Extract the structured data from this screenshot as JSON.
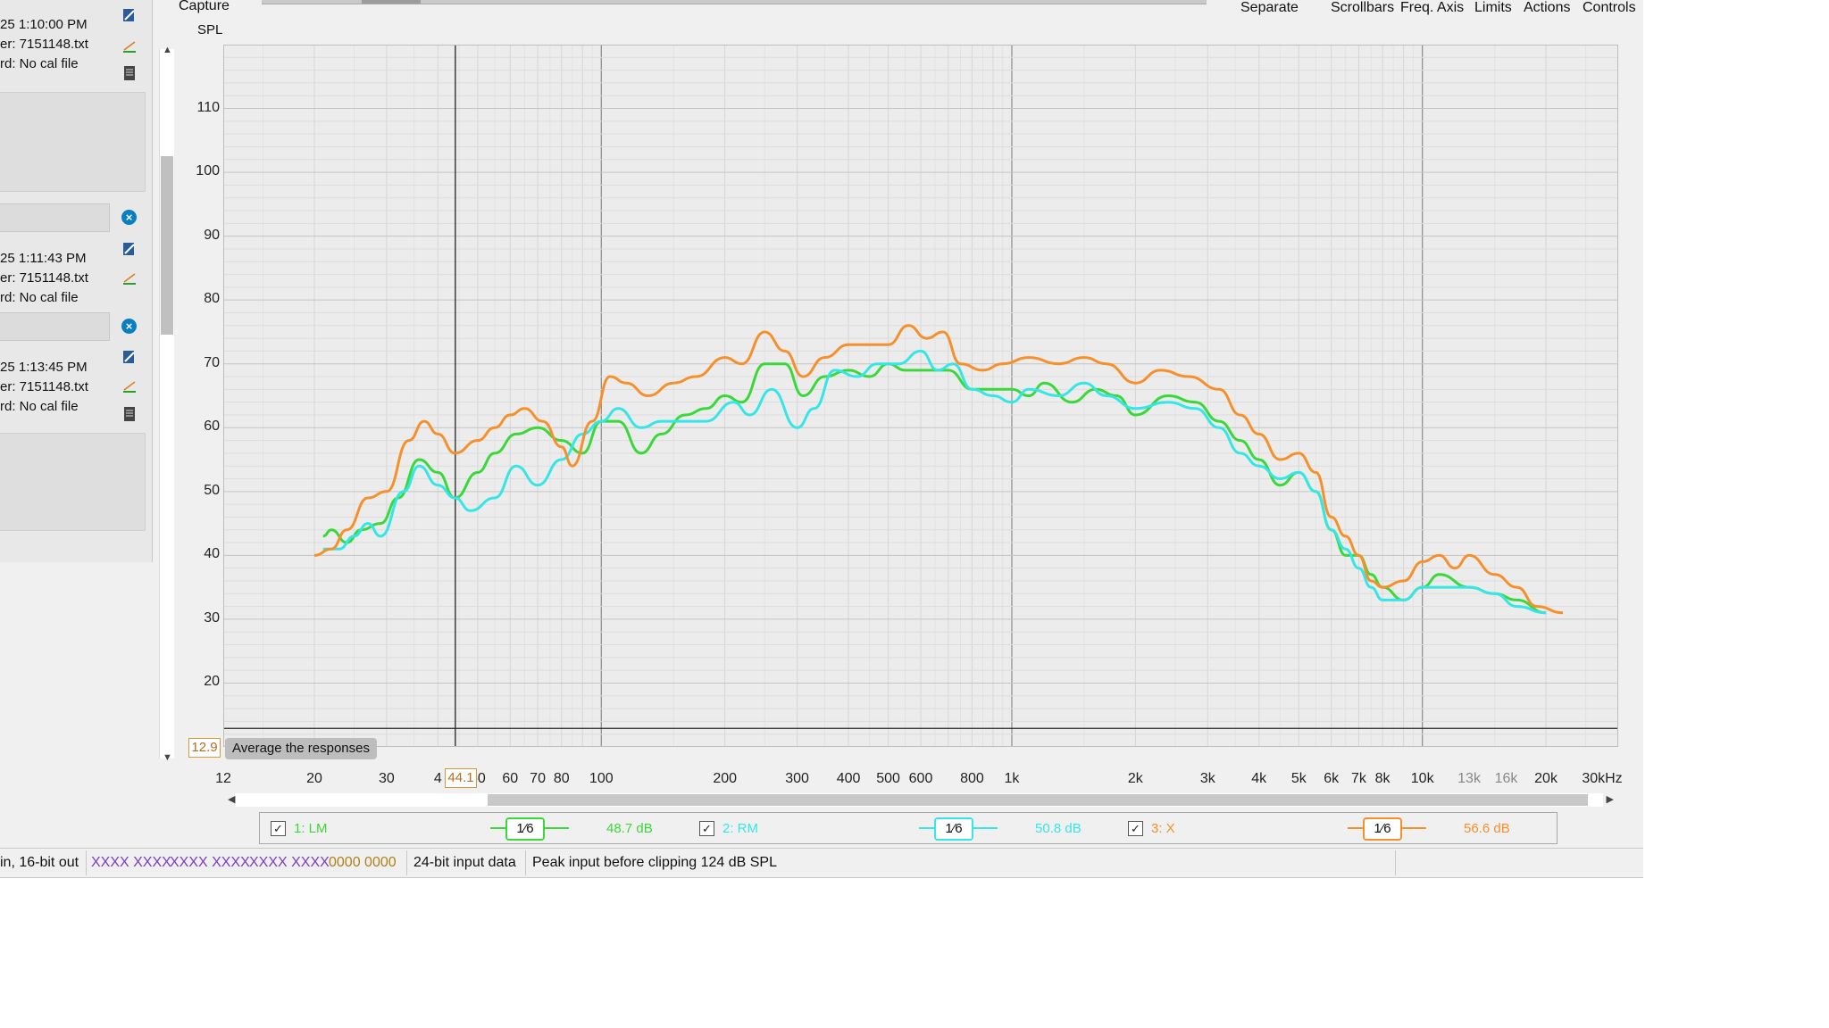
{
  "left_panel": {
    "measurements": [
      {
        "time": "25 1:10:00 PM",
        "mic": "er: 7151148.txt",
        "cal": "rd: No cal file"
      },
      {
        "time": "25 1:11:43 PM",
        "mic": "er: 7151148.txt",
        "cal": "rd: No cal file"
      },
      {
        "time": "25 1:13:45 PM",
        "mic": "er: 7151148.txt",
        "cal": "rd: No cal file"
      }
    ]
  },
  "toolbar": {
    "capture_label": "Capture",
    "menu": [
      "Separate",
      "Scrollbars",
      "Freq. Axis",
      "Limits",
      "Actions",
      "Controls"
    ]
  },
  "chart": {
    "y_axis_label": "SPL",
    "y_ticks": [
      "110",
      "100",
      "90",
      "80",
      "70",
      "60",
      "50",
      "40",
      "30",
      "20"
    ],
    "x_ticks": [
      {
        "label": "12",
        "f": 12,
        "dim": false
      },
      {
        "label": "20",
        "f": 20,
        "dim": false
      },
      {
        "label": "30",
        "f": 30,
        "dim": false
      },
      {
        "label": "4",
        "f": 40,
        "dim": false
      },
      {
        "label": "50",
        "f": 50,
        "dim": false
      },
      {
        "label": "60",
        "f": 60,
        "dim": false
      },
      {
        "label": "70",
        "f": 70,
        "dim": false
      },
      {
        "label": "80",
        "f": 80,
        "dim": false
      },
      {
        "label": "100",
        "f": 100,
        "dim": false
      },
      {
        "label": "200",
        "f": 200,
        "dim": false
      },
      {
        "label": "300",
        "f": 300,
        "dim": false
      },
      {
        "label": "400",
        "f": 400,
        "dim": false
      },
      {
        "label": "500",
        "f": 500,
        "dim": false
      },
      {
        "label": "600",
        "f": 600,
        "dim": false
      },
      {
        "label": "800",
        "f": 800,
        "dim": false
      },
      {
        "label": "1k",
        "f": 1000,
        "dim": false
      },
      {
        "label": "2k",
        "f": 2000,
        "dim": false
      },
      {
        "label": "3k",
        "f": 3000,
        "dim": false
      },
      {
        "label": "4k",
        "f": 4000,
        "dim": false
      },
      {
        "label": "5k",
        "f": 5000,
        "dim": false
      },
      {
        "label": "6k",
        "f": 6000,
        "dim": false
      },
      {
        "label": "7k",
        "f": 7000,
        "dim": false
      },
      {
        "label": "8k",
        "f": 8000,
        "dim": false
      },
      {
        "label": "10k",
        "f": 10000,
        "dim": false
      },
      {
        "label": "13k",
        "f": 13000,
        "dim": true
      },
      {
        "label": "16k",
        "f": 16000,
        "dim": true
      },
      {
        "label": "20k",
        "f": 20000,
        "dim": false
      },
      {
        "label": "30kHz",
        "f": 30000,
        "dim": false
      }
    ],
    "cursor_y_value": "12.9",
    "cursor_x_value": "44.1",
    "tooltip": "Average the responses"
  },
  "chart_data": {
    "type": "line",
    "x_scale": "log",
    "xlim": [
      12,
      30000
    ],
    "ylim": [
      10,
      120
    ],
    "series": [
      {
        "name": "1: LM",
        "color": "#3ad83a",
        "points": [
          [
            21,
            43
          ],
          [
            22,
            44
          ],
          [
            24,
            42
          ],
          [
            26,
            44
          ],
          [
            29,
            45
          ],
          [
            32,
            49
          ],
          [
            36,
            55
          ],
          [
            40,
            53
          ],
          [
            44,
            49
          ],
          [
            50,
            53
          ],
          [
            55,
            56
          ],
          [
            62,
            59
          ],
          [
            70,
            60
          ],
          [
            80,
            58
          ],
          [
            90,
            56
          ],
          [
            100,
            61
          ],
          [
            110,
            61
          ],
          [
            125,
            56
          ],
          [
            140,
            59
          ],
          [
            160,
            62
          ],
          [
            180,
            63
          ],
          [
            200,
            65
          ],
          [
            220,
            64
          ],
          [
            250,
            70
          ],
          [
            280,
            70
          ],
          [
            310,
            65
          ],
          [
            350,
            68
          ],
          [
            400,
            69
          ],
          [
            450,
            68
          ],
          [
            500,
            70
          ],
          [
            550,
            69
          ],
          [
            600,
            69
          ],
          [
            700,
            69
          ],
          [
            800,
            66
          ],
          [
            900,
            66
          ],
          [
            1000,
            66
          ],
          [
            1100,
            65
          ],
          [
            1200,
            67
          ],
          [
            1400,
            64
          ],
          [
            1600,
            66
          ],
          [
            1800,
            65
          ],
          [
            2000,
            62
          ],
          [
            2400,
            65
          ],
          [
            2800,
            64
          ],
          [
            3200,
            61
          ],
          [
            3600,
            58
          ],
          [
            4000,
            55
          ],
          [
            4500,
            51
          ],
          [
            5000,
            53
          ],
          [
            5500,
            50
          ],
          [
            6000,
            44
          ],
          [
            6500,
            40
          ],
          [
            7000,
            40
          ],
          [
            7500,
            37
          ],
          [
            8000,
            35
          ],
          [
            9000,
            33
          ],
          [
            10000,
            35
          ],
          [
            11000,
            37
          ],
          [
            13000,
            35
          ],
          [
            15000,
            34
          ],
          [
            17000,
            33
          ],
          [
            20000,
            31
          ]
        ]
      },
      {
        "name": "2: RM",
        "color": "#36e6e6",
        "points": [
          [
            21,
            41
          ],
          [
            23,
            41
          ],
          [
            25,
            43
          ],
          [
            27,
            45
          ],
          [
            29,
            43
          ],
          [
            33,
            50
          ],
          [
            36,
            54
          ],
          [
            40,
            51
          ],
          [
            44,
            49
          ],
          [
            48,
            47
          ],
          [
            55,
            49
          ],
          [
            62,
            54
          ],
          [
            70,
            51
          ],
          [
            80,
            55
          ],
          [
            90,
            59
          ],
          [
            100,
            61
          ],
          [
            110,
            63
          ],
          [
            125,
            60
          ],
          [
            140,
            61
          ],
          [
            160,
            61
          ],
          [
            180,
            61
          ],
          [
            210,
            64
          ],
          [
            230,
            62
          ],
          [
            260,
            66
          ],
          [
            300,
            60
          ],
          [
            330,
            63
          ],
          [
            370,
            69
          ],
          [
            420,
            68
          ],
          [
            470,
            70
          ],
          [
            530,
            70
          ],
          [
            600,
            72
          ],
          [
            660,
            69
          ],
          [
            720,
            70
          ],
          [
            800,
            66
          ],
          [
            900,
            65
          ],
          [
            1000,
            64
          ],
          [
            1100,
            66
          ],
          [
            1300,
            65
          ],
          [
            1500,
            67
          ],
          [
            1700,
            65
          ],
          [
            2000,
            63
          ],
          [
            2400,
            64
          ],
          [
            2800,
            63
          ],
          [
            3200,
            60
          ],
          [
            3600,
            56
          ],
          [
            4000,
            54
          ],
          [
            4500,
            52
          ],
          [
            5000,
            53
          ],
          [
            5500,
            50
          ],
          [
            6000,
            44
          ],
          [
            6500,
            41
          ],
          [
            7000,
            38
          ],
          [
            7500,
            35
          ],
          [
            8000,
            33
          ],
          [
            9000,
            33
          ],
          [
            10000,
            35
          ],
          [
            11000,
            35
          ],
          [
            13000,
            35
          ],
          [
            15000,
            34
          ],
          [
            17000,
            32
          ],
          [
            20000,
            31
          ]
        ]
      },
      {
        "name": "3: X",
        "color": "#f5902c",
        "points": [
          [
            20,
            40
          ],
          [
            22,
            41
          ],
          [
            24,
            44
          ],
          [
            27,
            49
          ],
          [
            30,
            50
          ],
          [
            34,
            58
          ],
          [
            37,
            61
          ],
          [
            40,
            59
          ],
          [
            44,
            56
          ],
          [
            50,
            58
          ],
          [
            55,
            60
          ],
          [
            60,
            62
          ],
          [
            65,
            63
          ],
          [
            72,
            61
          ],
          [
            80,
            57
          ],
          [
            85,
            54
          ],
          [
            95,
            61
          ],
          [
            105,
            68
          ],
          [
            115,
            67
          ],
          [
            130,
            65
          ],
          [
            150,
            67
          ],
          [
            170,
            68
          ],
          [
            200,
            71
          ],
          [
            220,
            70
          ],
          [
            250,
            75
          ],
          [
            280,
            72
          ],
          [
            310,
            68
          ],
          [
            350,
            71
          ],
          [
            400,
            73
          ],
          [
            450,
            73
          ],
          [
            500,
            73
          ],
          [
            560,
            76
          ],
          [
            620,
            74
          ],
          [
            680,
            75
          ],
          [
            750,
            70
          ],
          [
            850,
            69
          ],
          [
            950,
            70
          ],
          [
            1100,
            71
          ],
          [
            1300,
            70
          ],
          [
            1500,
            71
          ],
          [
            1700,
            70
          ],
          [
            2000,
            67
          ],
          [
            2300,
            69
          ],
          [
            2700,
            68
          ],
          [
            3200,
            66
          ],
          [
            3600,
            62
          ],
          [
            4000,
            59
          ],
          [
            4500,
            55
          ],
          [
            5000,
            56
          ],
          [
            5500,
            53
          ],
          [
            6000,
            46
          ],
          [
            6500,
            43
          ],
          [
            7000,
            40
          ],
          [
            7500,
            36
          ],
          [
            8000,
            35
          ],
          [
            9000,
            36
          ],
          [
            10000,
            39
          ],
          [
            11000,
            40
          ],
          [
            12000,
            38
          ],
          [
            13000,
            40
          ],
          [
            15000,
            37
          ],
          [
            17000,
            35
          ],
          [
            19000,
            32
          ],
          [
            22000,
            31
          ]
        ]
      }
    ],
    "ylabel": "SPL",
    "grid": true
  },
  "legend": {
    "items": [
      {
        "label": "1: LM",
        "smoothing": "1⁄6",
        "db": "48.7 dB",
        "color": "#3ad83a",
        "checked": "✓"
      },
      {
        "label": "2: RM",
        "smoothing": "1⁄6",
        "db": "50.8 dB",
        "color": "#36e6e6",
        "checked": "✓"
      },
      {
        "label": "3: X",
        "smoothing": "1⁄6",
        "db": "56.6 dB",
        "color": "#f5902c",
        "checked": "✓"
      }
    ]
  },
  "statusbar": {
    "bitdepth": "in, 16-bit out",
    "levels": [
      "XXXX XXXX",
      "XXXX XXXX",
      "XXXX XXXX"
    ],
    "level_zero": "0000 0000",
    "input_format": "24-bit input data",
    "peak": "Peak input before clipping 124 dB SPL"
  },
  "colors": {
    "levels": "#7a3dc8",
    "level_zero": "#b0801a"
  }
}
